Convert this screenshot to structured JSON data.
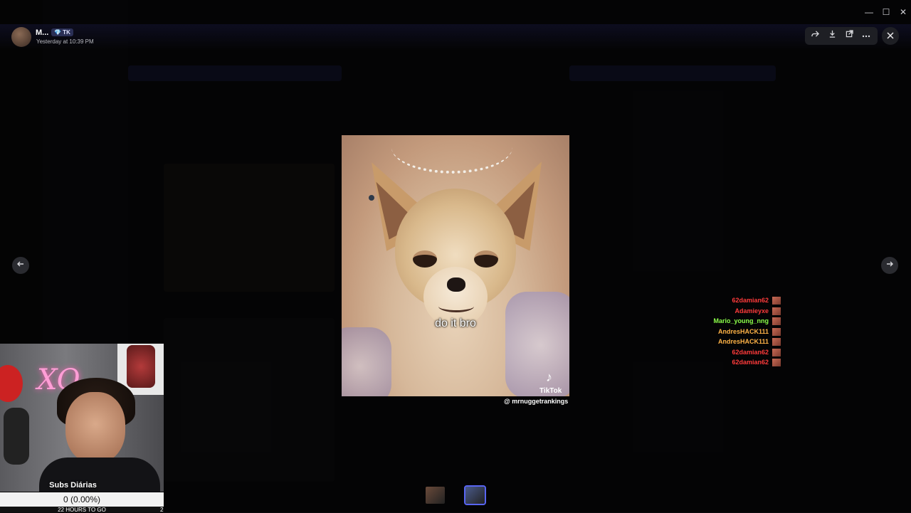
{
  "window": {
    "minimize": "—",
    "maximize": "☐",
    "close": "✕"
  },
  "viewer": {
    "author_name": "M...",
    "author_badge": "💎 TK",
    "timestamp": "Yesterday at 10:39 PM",
    "tools": {
      "forward_icon": "share-forward-icon",
      "download_icon": "download-icon",
      "open_icon": "open-external-icon",
      "more_icon": "more-icon",
      "close_icon": "close-icon"
    },
    "media": {
      "caption": "do it bro",
      "tiktok_label": "TikTok",
      "handle": "@ mrnuggetrankings"
    }
  },
  "chat": [
    {
      "user": "62damian62",
      "color": "#ff3b3b"
    },
    {
      "user": "Adamieyxe",
      "color": "#ff3b3b"
    },
    {
      "user": "Mario_young_nng",
      "color": "#8cff4a"
    },
    {
      "user": "AndresHACK111",
      "color": "#ffb347"
    },
    {
      "user": "AndresHACK111",
      "color": "#ffb347"
    },
    {
      "user": "62damian62",
      "color": "#ff3b3b"
    },
    {
      "user": "62damian62",
      "color": "#ff3b3b"
    }
  ],
  "overlay": {
    "subs_title": "Subs Diárias",
    "subs_progress": "0 (0.00%)",
    "subs_fraction": 0.0,
    "hours_to_go": "22 HOURS TO GO",
    "hours_count": "2"
  },
  "thumbnails": [
    {
      "name": "thumbnail-1",
      "color": "#6a4a3a"
    },
    {
      "name": "thumbnail-2",
      "color": "#4a5a8a"
    }
  ]
}
